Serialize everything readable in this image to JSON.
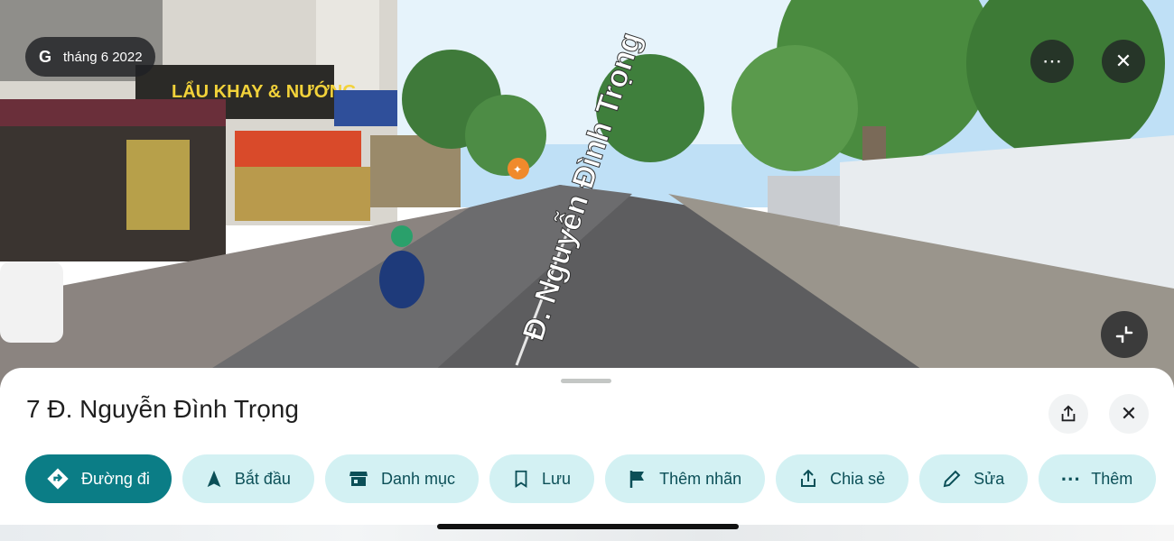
{
  "street_view": {
    "date_label": "tháng 6 2022",
    "provider_icon": "google-g-icon",
    "road_label": "Đ. Nguyễn Đình Trọng",
    "sign_text": "LẨU KHAY & NƯỚNG",
    "buttons": {
      "more": "more-icon",
      "close": "close-icon",
      "exit_fullscreen": "collapse-icon"
    }
  },
  "place": {
    "title": "7 Đ. Nguyễn Đình Trọng"
  },
  "actions": [
    {
      "name": "directions",
      "label": "Đường đi",
      "icon": "directions-icon"
    },
    {
      "name": "start",
      "label": "Bắt đầu",
      "icon": "navigation-arrow-icon"
    },
    {
      "name": "menu",
      "label": "Danh mục",
      "icon": "store-icon"
    },
    {
      "name": "save",
      "label": "Lưu",
      "icon": "bookmark-icon"
    },
    {
      "name": "add-label",
      "label": "Thêm nhãn",
      "icon": "flag-icon"
    },
    {
      "name": "share",
      "label": "Chia sẻ",
      "icon": "share-icon"
    },
    {
      "name": "edit",
      "label": "Sửa",
      "icon": "pencil-icon"
    },
    {
      "name": "more",
      "label": "Thêm",
      "icon": "more-icon"
    }
  ],
  "colors": {
    "primary": "#0b7d86",
    "chip_bg": "#d3f1f3",
    "chip_text": "#0b4f57"
  }
}
